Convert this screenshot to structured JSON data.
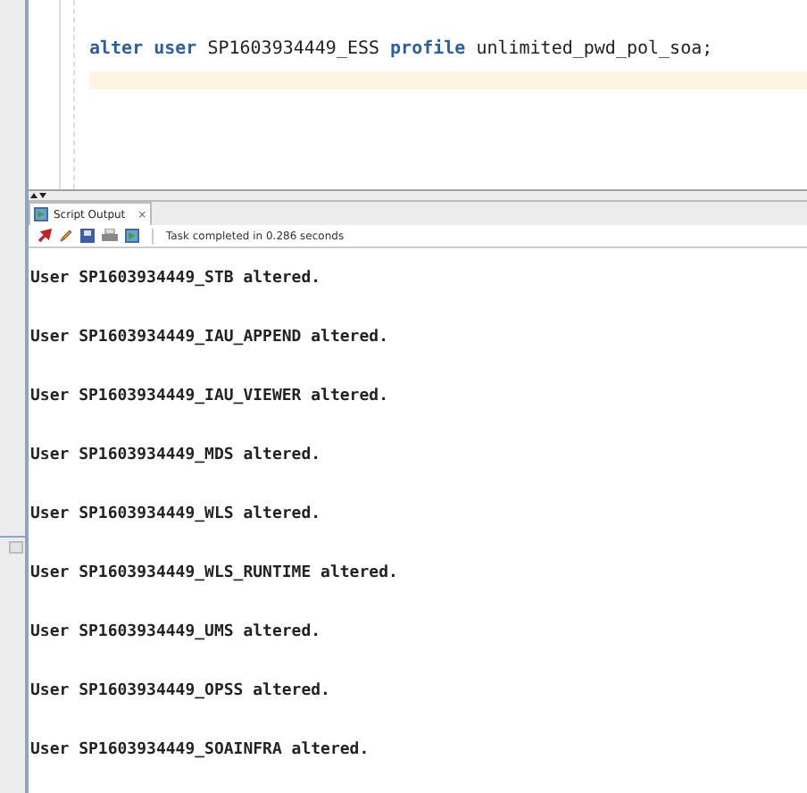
{
  "editor": {
    "code": [
      {
        "text": "alter",
        "kind": "keyword"
      },
      {
        "text": "user",
        "kind": "keyword"
      },
      {
        "text": "SP1603934449_ESS",
        "kind": "plain"
      },
      {
        "text": "profile",
        "kind": "keyword"
      },
      {
        "text": "unlimited_pwd_pol_soa;",
        "kind": "plain"
      }
    ]
  },
  "output_panel": {
    "tab": {
      "label": "Script Output",
      "close": "×",
      "selected": true
    },
    "status": "Task completed in 0.286 seconds",
    "lines": [
      "User SP1603934449_STB altered.",
      "User SP1603934449_IAU_APPEND altered.",
      "User SP1603934449_IAU_VIEWER altered.",
      "User SP1603934449_MDS altered.",
      "User SP1603934449_WLS altered.",
      "User SP1603934449_WLS_RUNTIME altered.",
      "User SP1603934449_UMS altered.",
      "User SP1603934449_OPSS altered.",
      "User SP1603934449_SOAINFRA altered."
    ]
  }
}
